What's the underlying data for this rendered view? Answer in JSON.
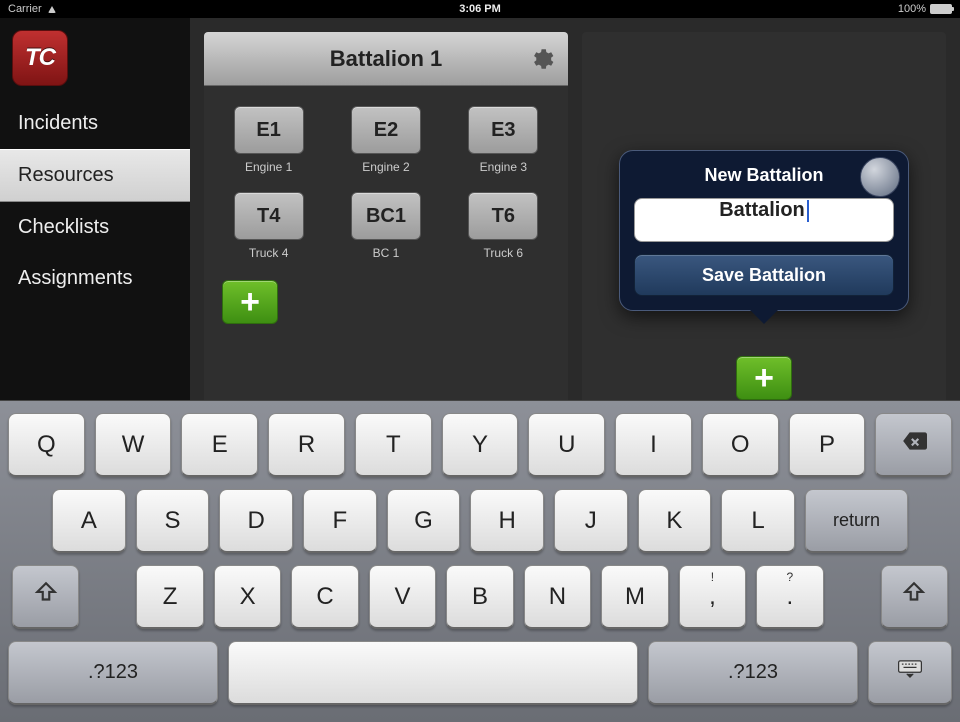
{
  "status_bar": {
    "carrier": "Carrier",
    "time": "3:06 PM",
    "battery": "100%"
  },
  "logo_text": "TC",
  "nav": {
    "items": [
      {
        "label": "Incidents",
        "selected": false
      },
      {
        "label": "Resources",
        "selected": true
      },
      {
        "label": "Checklists",
        "selected": false
      },
      {
        "label": "Assignments",
        "selected": false
      }
    ]
  },
  "battalion_panel": {
    "title": "Battalion 1",
    "units": [
      {
        "code": "E1",
        "name": "Engine 1"
      },
      {
        "code": "E2",
        "name": "Engine 2"
      },
      {
        "code": "E3",
        "name": "Engine 3"
      },
      {
        "code": "T4",
        "name": "Truck 4"
      },
      {
        "code": "BC1",
        "name": "BC 1"
      },
      {
        "code": "T6",
        "name": "Truck 6"
      }
    ],
    "add_label": "+"
  },
  "new_battalion_popover": {
    "title": "New Battalion",
    "input_value": "Battalion",
    "save_label": "Save Battalion"
  },
  "right_panel": {
    "add_label": "+"
  },
  "keyboard": {
    "row1": [
      "Q",
      "W",
      "E",
      "R",
      "T",
      "Y",
      "U",
      "I",
      "O",
      "P"
    ],
    "row2": [
      "A",
      "S",
      "D",
      "F",
      "G",
      "H",
      "J",
      "K",
      "L"
    ],
    "row3": [
      "Z",
      "X",
      "C",
      "V",
      "B",
      "N",
      "M"
    ],
    "row3_punct": {
      "comma_alt": "!",
      "comma": ",",
      "period_alt": "?",
      "period": "."
    },
    "return_label": "return",
    "numswitch_label": ".?123"
  }
}
